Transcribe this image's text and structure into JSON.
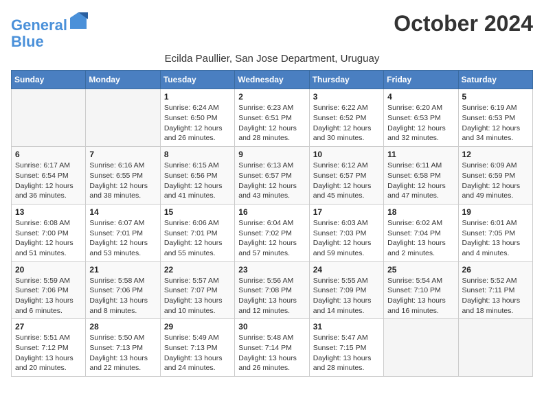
{
  "header": {
    "logo_line1": "General",
    "logo_line2": "Blue",
    "month_title": "October 2024",
    "subtitle": "Ecilda Paullier, San Jose Department, Uruguay"
  },
  "days_of_week": [
    "Sunday",
    "Monday",
    "Tuesday",
    "Wednesday",
    "Thursday",
    "Friday",
    "Saturday"
  ],
  "weeks": [
    [
      {
        "num": "",
        "sunrise": "",
        "sunset": "",
        "daylight": "",
        "empty": true
      },
      {
        "num": "",
        "sunrise": "",
        "sunset": "",
        "daylight": "",
        "empty": true
      },
      {
        "num": "1",
        "sunrise": "Sunrise: 6:24 AM",
        "sunset": "Sunset: 6:50 PM",
        "daylight": "Daylight: 12 hours and 26 minutes."
      },
      {
        "num": "2",
        "sunrise": "Sunrise: 6:23 AM",
        "sunset": "Sunset: 6:51 PM",
        "daylight": "Daylight: 12 hours and 28 minutes."
      },
      {
        "num": "3",
        "sunrise": "Sunrise: 6:22 AM",
        "sunset": "Sunset: 6:52 PM",
        "daylight": "Daylight: 12 hours and 30 minutes."
      },
      {
        "num": "4",
        "sunrise": "Sunrise: 6:20 AM",
        "sunset": "Sunset: 6:53 PM",
        "daylight": "Daylight: 12 hours and 32 minutes."
      },
      {
        "num": "5",
        "sunrise": "Sunrise: 6:19 AM",
        "sunset": "Sunset: 6:53 PM",
        "daylight": "Daylight: 12 hours and 34 minutes."
      }
    ],
    [
      {
        "num": "6",
        "sunrise": "Sunrise: 6:17 AM",
        "sunset": "Sunset: 6:54 PM",
        "daylight": "Daylight: 12 hours and 36 minutes."
      },
      {
        "num": "7",
        "sunrise": "Sunrise: 6:16 AM",
        "sunset": "Sunset: 6:55 PM",
        "daylight": "Daylight: 12 hours and 38 minutes."
      },
      {
        "num": "8",
        "sunrise": "Sunrise: 6:15 AM",
        "sunset": "Sunset: 6:56 PM",
        "daylight": "Daylight: 12 hours and 41 minutes."
      },
      {
        "num": "9",
        "sunrise": "Sunrise: 6:13 AM",
        "sunset": "Sunset: 6:57 PM",
        "daylight": "Daylight: 12 hours and 43 minutes."
      },
      {
        "num": "10",
        "sunrise": "Sunrise: 6:12 AM",
        "sunset": "Sunset: 6:57 PM",
        "daylight": "Daylight: 12 hours and 45 minutes."
      },
      {
        "num": "11",
        "sunrise": "Sunrise: 6:11 AM",
        "sunset": "Sunset: 6:58 PM",
        "daylight": "Daylight: 12 hours and 47 minutes."
      },
      {
        "num": "12",
        "sunrise": "Sunrise: 6:09 AM",
        "sunset": "Sunset: 6:59 PM",
        "daylight": "Daylight: 12 hours and 49 minutes."
      }
    ],
    [
      {
        "num": "13",
        "sunrise": "Sunrise: 6:08 AM",
        "sunset": "Sunset: 7:00 PM",
        "daylight": "Daylight: 12 hours and 51 minutes."
      },
      {
        "num": "14",
        "sunrise": "Sunrise: 6:07 AM",
        "sunset": "Sunset: 7:01 PM",
        "daylight": "Daylight: 12 hours and 53 minutes."
      },
      {
        "num": "15",
        "sunrise": "Sunrise: 6:06 AM",
        "sunset": "Sunset: 7:01 PM",
        "daylight": "Daylight: 12 hours and 55 minutes."
      },
      {
        "num": "16",
        "sunrise": "Sunrise: 6:04 AM",
        "sunset": "Sunset: 7:02 PM",
        "daylight": "Daylight: 12 hours and 57 minutes."
      },
      {
        "num": "17",
        "sunrise": "Sunrise: 6:03 AM",
        "sunset": "Sunset: 7:03 PM",
        "daylight": "Daylight: 12 hours and 59 minutes."
      },
      {
        "num": "18",
        "sunrise": "Sunrise: 6:02 AM",
        "sunset": "Sunset: 7:04 PM",
        "daylight": "Daylight: 13 hours and 2 minutes."
      },
      {
        "num": "19",
        "sunrise": "Sunrise: 6:01 AM",
        "sunset": "Sunset: 7:05 PM",
        "daylight": "Daylight: 13 hours and 4 minutes."
      }
    ],
    [
      {
        "num": "20",
        "sunrise": "Sunrise: 5:59 AM",
        "sunset": "Sunset: 7:06 PM",
        "daylight": "Daylight: 13 hours and 6 minutes."
      },
      {
        "num": "21",
        "sunrise": "Sunrise: 5:58 AM",
        "sunset": "Sunset: 7:06 PM",
        "daylight": "Daylight: 13 hours and 8 minutes."
      },
      {
        "num": "22",
        "sunrise": "Sunrise: 5:57 AM",
        "sunset": "Sunset: 7:07 PM",
        "daylight": "Daylight: 13 hours and 10 minutes."
      },
      {
        "num": "23",
        "sunrise": "Sunrise: 5:56 AM",
        "sunset": "Sunset: 7:08 PM",
        "daylight": "Daylight: 13 hours and 12 minutes."
      },
      {
        "num": "24",
        "sunrise": "Sunrise: 5:55 AM",
        "sunset": "Sunset: 7:09 PM",
        "daylight": "Daylight: 13 hours and 14 minutes."
      },
      {
        "num": "25",
        "sunrise": "Sunrise: 5:54 AM",
        "sunset": "Sunset: 7:10 PM",
        "daylight": "Daylight: 13 hours and 16 minutes."
      },
      {
        "num": "26",
        "sunrise": "Sunrise: 5:52 AM",
        "sunset": "Sunset: 7:11 PM",
        "daylight": "Daylight: 13 hours and 18 minutes."
      }
    ],
    [
      {
        "num": "27",
        "sunrise": "Sunrise: 5:51 AM",
        "sunset": "Sunset: 7:12 PM",
        "daylight": "Daylight: 13 hours and 20 minutes."
      },
      {
        "num": "28",
        "sunrise": "Sunrise: 5:50 AM",
        "sunset": "Sunset: 7:13 PM",
        "daylight": "Daylight: 13 hours and 22 minutes."
      },
      {
        "num": "29",
        "sunrise": "Sunrise: 5:49 AM",
        "sunset": "Sunset: 7:13 PM",
        "daylight": "Daylight: 13 hours and 24 minutes."
      },
      {
        "num": "30",
        "sunrise": "Sunrise: 5:48 AM",
        "sunset": "Sunset: 7:14 PM",
        "daylight": "Daylight: 13 hours and 26 minutes."
      },
      {
        "num": "31",
        "sunrise": "Sunrise: 5:47 AM",
        "sunset": "Sunset: 7:15 PM",
        "daylight": "Daylight: 13 hours and 28 minutes."
      },
      {
        "num": "",
        "sunrise": "",
        "sunset": "",
        "daylight": "",
        "empty": true
      },
      {
        "num": "",
        "sunrise": "",
        "sunset": "",
        "daylight": "",
        "empty": true
      }
    ]
  ]
}
